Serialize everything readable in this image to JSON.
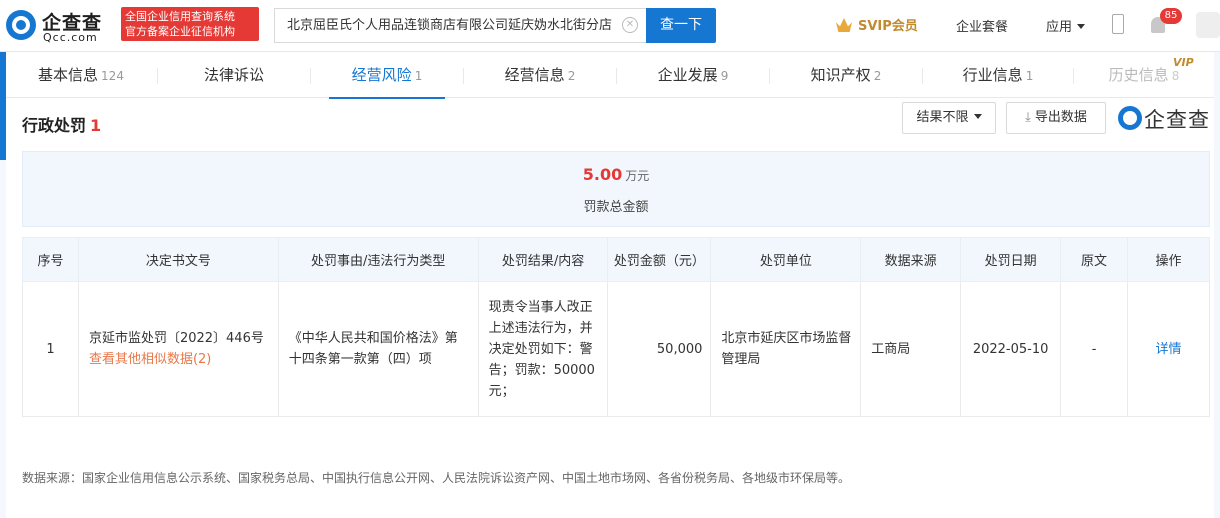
{
  "header": {
    "logo_cn": "企查查",
    "logo_en": "Qcc.com",
    "badge_line1": "全国企业信用查询系统",
    "badge_line2": "官方备案企业征信机构",
    "search_value": "北京屈臣氏个人用品连锁商店有限公司延庆妫水北街分店",
    "search_button": "查一下",
    "svip_label": "SVIP会员",
    "nav_package": "企业套餐",
    "nav_apps": "应用",
    "notification_count": "85"
  },
  "tabs": [
    {
      "label": "基本信息",
      "count": "124"
    },
    {
      "label": "法律诉讼",
      "count": ""
    },
    {
      "label": "经营风险",
      "count": "1"
    },
    {
      "label": "经营信息",
      "count": "2"
    },
    {
      "label": "企业发展",
      "count": "9"
    },
    {
      "label": "知识产权",
      "count": "2"
    },
    {
      "label": "行业信息",
      "count": "1"
    },
    {
      "label": "历史信息",
      "count": "8"
    }
  ],
  "history_vip_tag": "VIP",
  "section": {
    "title": "行政处罚",
    "count": "1",
    "filter_label": "结果不限",
    "export_label": "导出数据",
    "brand_text": "企查查"
  },
  "summary": {
    "amount": "5.00",
    "unit": "万元",
    "label": "罚款总金额"
  },
  "table": {
    "headers": [
      "序号",
      "决定书文号",
      "处罚事由/违法行为类型",
      "处罚结果/内容",
      "处罚金额（元）",
      "处罚单位",
      "数据来源",
      "处罚日期",
      "原文",
      "操作"
    ],
    "rows": [
      {
        "index": "1",
        "doc_no": "京延市监处罚〔2022〕446号",
        "similar_link": "查看其他相似数据(2)",
        "reason": "《中华人民共和国价格法》第十四条第一款第（四）项",
        "result": "现责令当事人改正上述违法行为，并决定处罚如下：警告；罚款：50000元；",
        "amount": "50,000",
        "authority": "北京市延庆区市场监督管理局",
        "source": "工商局",
        "date": "2022-05-10",
        "original": "-",
        "action": "详情"
      }
    ]
  },
  "footer": "数据来源：国家企业信用信息公示系统、国家税务总局、中国执行信息公开网、人民法院诉讼资产网、中国土地市场网、各省份税务局、各地级市环保局等。",
  "colors": {
    "primary": "#1677d2",
    "danger": "#e53935",
    "link_orange": "#e8784a",
    "vip_gold": "#c18a2e"
  }
}
